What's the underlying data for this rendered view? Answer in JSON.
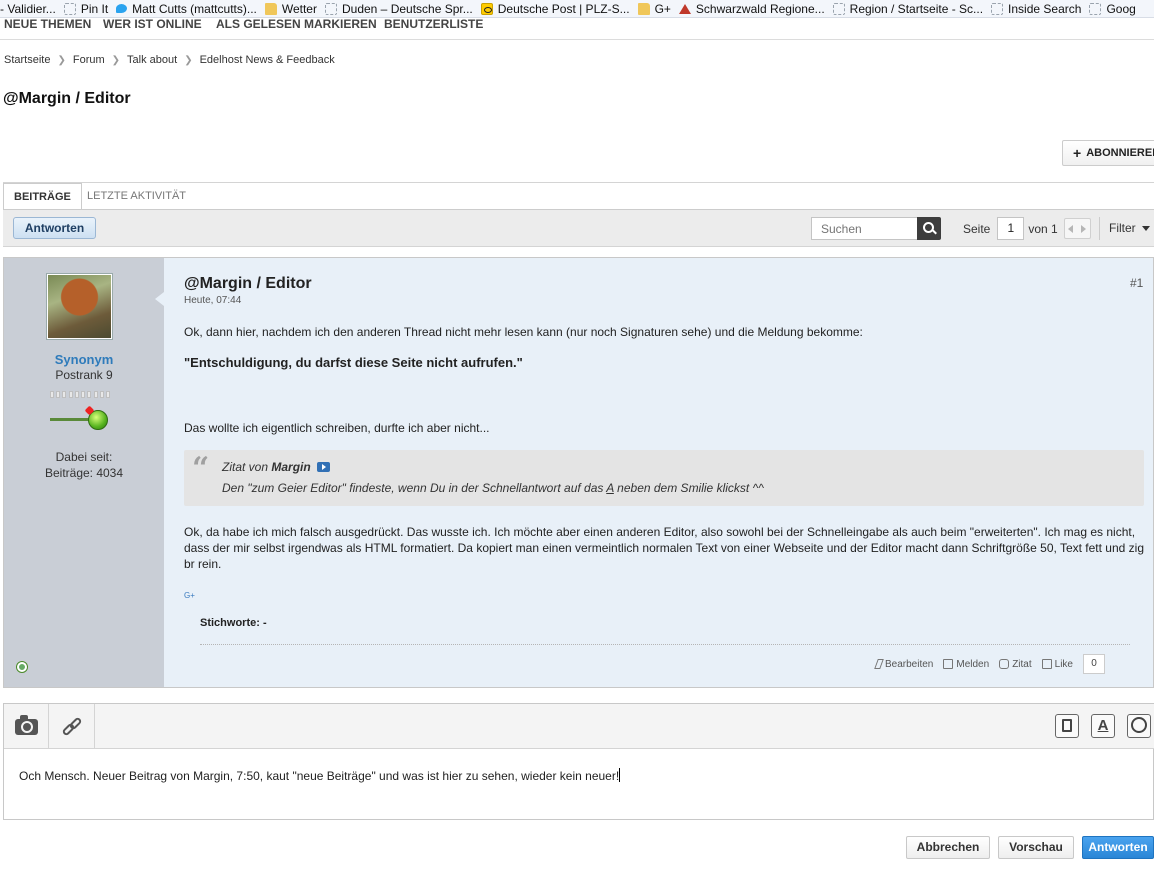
{
  "bookmarks": [
    {
      "label": "- Validier...",
      "icon": "none"
    },
    {
      "label": "Pin It",
      "icon": "page-icon"
    },
    {
      "label": "Matt Cutts (mattcutts)...",
      "icon": "twitter-icon"
    },
    {
      "label": "Wetter",
      "icon": "folder-icon"
    },
    {
      "label": "Duden – Deutsche Spr...",
      "icon": "page-icon"
    },
    {
      "label": "Deutsche Post | PLZ-S...",
      "icon": "post-horn-icon"
    },
    {
      "label": "G+",
      "icon": "folder-icon"
    },
    {
      "label": "Schwarzwald Regione...",
      "icon": "home-icon"
    },
    {
      "label": "Region / Startseite - Sc...",
      "icon": "page-icon"
    },
    {
      "label": "Inside Search",
      "icon": "page-icon"
    },
    {
      "label": "Goog",
      "icon": "page-icon"
    }
  ],
  "subnav": [
    "NEUE THEMEN",
    "WER IST ONLINE",
    "ALS GELESEN MARKIEREN",
    "BENUTZERLISTE"
  ],
  "breadcrumb": [
    "Startseite",
    "Forum",
    "Talk about",
    "Edelhost News & Feedback"
  ],
  "thread_title": "@Margin / Editor",
  "subscribe_label": "ABONNIEREN",
  "tabs": {
    "active": "BEITRÄGE",
    "inactive": "LETZTE AKTIVITÄT"
  },
  "toolbar": {
    "reply_label": "Antworten",
    "search_placeholder": "Suchen",
    "page_label": "Seite",
    "page_value": "1",
    "page_of": "von 1",
    "filter_label": "Filter"
  },
  "post": {
    "user": {
      "name": "Synonym",
      "rank": "Postrank 9",
      "since_label": "Dabei seit:",
      "posts_label": "Beiträge: 4034"
    },
    "title": "@Margin / Editor",
    "time": "Heute, 07:44",
    "number": "#1",
    "para1": "Ok, dann hier, nachdem ich den anderen Thread nicht mehr lesen kann (nur noch Signaturen sehe) und die Meldung bekomme:",
    "para2": "\"Entschuldigung, du darfst diese Seite nicht aufrufen.\"",
    "para3": "Das wollte ich eigentlich schreiben, durfte ich aber nicht...",
    "quote": {
      "prefix": "Zitat von",
      "author": "Margin",
      "text_before": "Den \"zum Geier Editor\" findeste, wenn Du in der Schnellantwort auf das ",
      "text_underlined": "A",
      "text_after": " neben dem Smilie klickst ^^"
    },
    "para4": "Ok, da habe ich mich falsch ausgedrückt. Das wusste ich. Ich möchte aber einen anderen Editor, also sowohl bei der Schnelleingabe als auch beim \"erweiterten\". Ich mag es nicht, dass der mir selbst irgendwas als HTML formatiert. Da kopiert man einen vermeintlich normalen Text von einer Webseite und der Editor macht dann Schriftgröße 50, Text fett und zig br rein.",
    "gplus": "G+",
    "tags_label": "Stichworte:",
    "tags_value": " -",
    "actions": {
      "edit": "Bearbeiten",
      "report": "Melden",
      "quote": "Zitat",
      "like": "Like",
      "like_count": "0"
    }
  },
  "editor": {
    "text": "Och Mensch. Neuer Beitrag von Margin, 7:50, kaut \"neue Beiträge\" und was ist hier zu sehen, wieder kein neuer!",
    "format_letter": "A"
  },
  "footer_buttons": {
    "cancel": "Abbrechen",
    "preview": "Vorschau",
    "reply": "Antworten"
  }
}
